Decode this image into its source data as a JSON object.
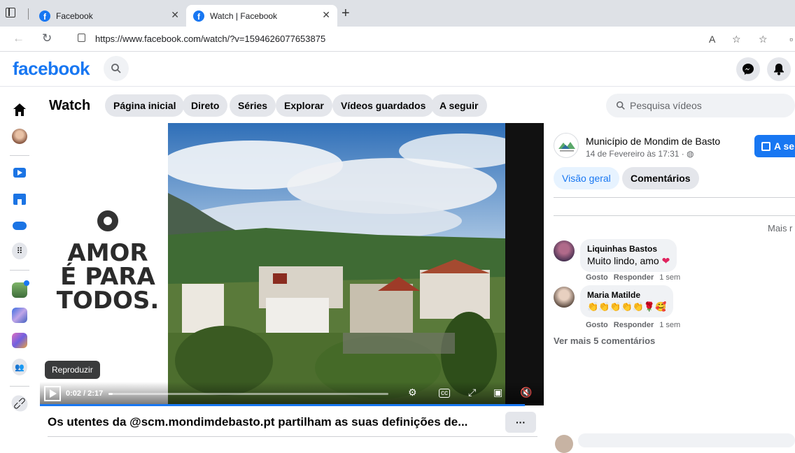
{
  "browser": {
    "tabs": [
      {
        "label": "Facebook",
        "active": false
      },
      {
        "label": "Watch | Facebook",
        "active": true
      }
    ],
    "url": "https://www.facebook.com/watch/?v=1594626077653875"
  },
  "header": {
    "logo": "facebook"
  },
  "watch": {
    "title": "Watch",
    "nav": [
      "Página inicial",
      "Direto",
      "Séries",
      "Explorar",
      "Vídeos guardados",
      "A seguir"
    ],
    "search_placeholder": "Pesquisa vídeos"
  },
  "video": {
    "overlay_line1": "AMOR",
    "overlay_line2": "É PARA",
    "overlay_line3": "TODOS.",
    "time": "0:02 / 2:17",
    "progress": 0.015,
    "tooltip": "Reproduzir",
    "title": "Os utentes da @scm.mondimdebasto.pt partilham as suas definições de...",
    "more_label": "···"
  },
  "post": {
    "page_name": "Município de Mondim de Basto",
    "date": "14 de Fevereiro às 17:31 · ",
    "follow_label": "A se",
    "tabs": [
      "Visão geral",
      "Comentários"
    ],
    "sort_label": "Mais r",
    "comments": [
      {
        "author": "Liquinhas Bastos",
        "text": "Muito lindo, amo ",
        "like": "Gosto",
        "reply": "Responder",
        "age": "1 sem"
      },
      {
        "author": "Maria Matilde",
        "text": "👏👏👏👏👏🌹🥰",
        "like": "Gosto",
        "reply": "Responder",
        "age": "1 sem"
      }
    ],
    "more_comments": "Ver mais 5 comentários"
  },
  "colors": {
    "brand": "#1877f2",
    "pill_bg": "#e4e6eb",
    "muted_text": "#65676b"
  }
}
